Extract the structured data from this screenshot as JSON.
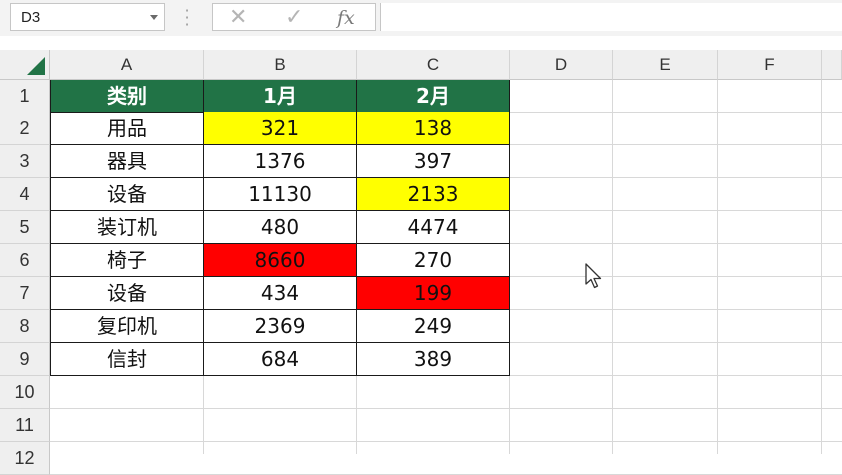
{
  "name_box": {
    "value": "D3"
  },
  "formula_bar": {
    "value": ""
  },
  "columns": [
    "A",
    "B",
    "C",
    "D",
    "E",
    "F"
  ],
  "rows": [
    "1",
    "2",
    "3",
    "4",
    "5",
    "6",
    "7",
    "8",
    "9",
    "10",
    "11",
    "12"
  ],
  "table": {
    "header": [
      "类别",
      "1月",
      "2月"
    ],
    "rows": [
      [
        "用品",
        "321",
        "138"
      ],
      [
        "器具",
        "1376",
        "397"
      ],
      [
        "设备",
        "11130",
        "2133"
      ],
      [
        "装订机",
        "480",
        "4474"
      ],
      [
        "椅子",
        "8660",
        "270"
      ],
      [
        "设备",
        "434",
        "199"
      ],
      [
        "复印机",
        "2369",
        "249"
      ],
      [
        "信封",
        "684",
        "389"
      ]
    ],
    "highlights": {
      "yellow": [
        [
          0,
          1
        ],
        [
          0,
          2
        ],
        [
          2,
          2
        ]
      ],
      "red": [
        [
          4,
          1
        ],
        [
          5,
          2
        ]
      ]
    }
  },
  "colors": {
    "header_fill": "#217346",
    "header_text": "#ffffff",
    "yellow_fill": "#ffff00",
    "red_fill": "#ff0000"
  },
  "icons": {
    "cancel": "close-icon",
    "enter": "check-icon",
    "function": "fx-icon",
    "cursor": "mouse-pointer-icon"
  }
}
